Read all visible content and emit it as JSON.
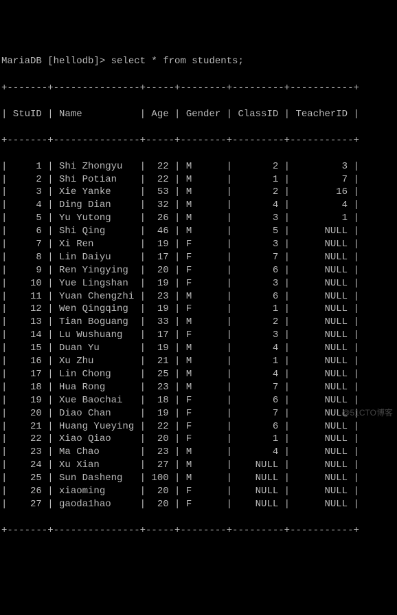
{
  "prompt": "MariaDB [hellodb]> select * from students;",
  "table": {
    "columns": [
      "StuID",
      "Name",
      "Age",
      "Gender",
      "ClassID",
      "TeacherID"
    ],
    "rows": [
      {
        "StuID": "1",
        "Name": "Shi Zhongyu",
        "Age": "22",
        "Gender": "M",
        "ClassID": "2",
        "TeacherID": "3"
      },
      {
        "StuID": "2",
        "Name": "Shi Potian",
        "Age": "22",
        "Gender": "M",
        "ClassID": "1",
        "TeacherID": "7"
      },
      {
        "StuID": "3",
        "Name": "Xie Yanke",
        "Age": "53",
        "Gender": "M",
        "ClassID": "2",
        "TeacherID": "16"
      },
      {
        "StuID": "4",
        "Name": "Ding Dian",
        "Age": "32",
        "Gender": "M",
        "ClassID": "4",
        "TeacherID": "4"
      },
      {
        "StuID": "5",
        "Name": "Yu Yutong",
        "Age": "26",
        "Gender": "M",
        "ClassID": "3",
        "TeacherID": "1"
      },
      {
        "StuID": "6",
        "Name": "Shi Qing",
        "Age": "46",
        "Gender": "M",
        "ClassID": "5",
        "TeacherID": "NULL"
      },
      {
        "StuID": "7",
        "Name": "Xi Ren",
        "Age": "19",
        "Gender": "F",
        "ClassID": "3",
        "TeacherID": "NULL"
      },
      {
        "StuID": "8",
        "Name": "Lin Daiyu",
        "Age": "17",
        "Gender": "F",
        "ClassID": "7",
        "TeacherID": "NULL"
      },
      {
        "StuID": "9",
        "Name": "Ren Yingying",
        "Age": "20",
        "Gender": "F",
        "ClassID": "6",
        "TeacherID": "NULL"
      },
      {
        "StuID": "10",
        "Name": "Yue Lingshan",
        "Age": "19",
        "Gender": "F",
        "ClassID": "3",
        "TeacherID": "NULL"
      },
      {
        "StuID": "11",
        "Name": "Yuan Chengzhi",
        "Age": "23",
        "Gender": "M",
        "ClassID": "6",
        "TeacherID": "NULL"
      },
      {
        "StuID": "12",
        "Name": "Wen Qingqing",
        "Age": "19",
        "Gender": "F",
        "ClassID": "1",
        "TeacherID": "NULL"
      },
      {
        "StuID": "13",
        "Name": "Tian Boguang",
        "Age": "33",
        "Gender": "M",
        "ClassID": "2",
        "TeacherID": "NULL"
      },
      {
        "StuID": "14",
        "Name": "Lu Wushuang",
        "Age": "17",
        "Gender": "F",
        "ClassID": "3",
        "TeacherID": "NULL"
      },
      {
        "StuID": "15",
        "Name": "Duan Yu",
        "Age": "19",
        "Gender": "M",
        "ClassID": "4",
        "TeacherID": "NULL"
      },
      {
        "StuID": "16",
        "Name": "Xu Zhu",
        "Age": "21",
        "Gender": "M",
        "ClassID": "1",
        "TeacherID": "NULL"
      },
      {
        "StuID": "17",
        "Name": "Lin Chong",
        "Age": "25",
        "Gender": "M",
        "ClassID": "4",
        "TeacherID": "NULL"
      },
      {
        "StuID": "18",
        "Name": "Hua Rong",
        "Age": "23",
        "Gender": "M",
        "ClassID": "7",
        "TeacherID": "NULL"
      },
      {
        "StuID": "19",
        "Name": "Xue Baochai",
        "Age": "18",
        "Gender": "F",
        "ClassID": "6",
        "TeacherID": "NULL"
      },
      {
        "StuID": "20",
        "Name": "Diao Chan",
        "Age": "19",
        "Gender": "F",
        "ClassID": "7",
        "TeacherID": "NULL"
      },
      {
        "StuID": "21",
        "Name": "Huang Yueying",
        "Age": "22",
        "Gender": "F",
        "ClassID": "6",
        "TeacherID": "NULL"
      },
      {
        "StuID": "22",
        "Name": "Xiao Qiao",
        "Age": "20",
        "Gender": "F",
        "ClassID": "1",
        "TeacherID": "NULL"
      },
      {
        "StuID": "23",
        "Name": "Ma Chao",
        "Age": "23",
        "Gender": "M",
        "ClassID": "4",
        "TeacherID": "NULL"
      },
      {
        "StuID": "24",
        "Name": "Xu Xian",
        "Age": "27",
        "Gender": "M",
        "ClassID": "NULL",
        "TeacherID": "NULL"
      },
      {
        "StuID": "25",
        "Name": "Sun Dasheng",
        "Age": "100",
        "Gender": "M",
        "ClassID": "NULL",
        "TeacherID": "NULL"
      },
      {
        "StuID": "26",
        "Name": "xiaoming",
        "Age": "20",
        "Gender": "F",
        "ClassID": "NULL",
        "TeacherID": "NULL"
      },
      {
        "StuID": "27",
        "Name": "gaoda1hao",
        "Age": "20",
        "Gender": "F",
        "ClassID": "NULL",
        "TeacherID": "NULL"
      }
    ]
  },
  "watermark": "@51CTO博客",
  "widths": {
    "StuID": 7,
    "Name": 15,
    "Age": 5,
    "Gender": 8,
    "ClassID": 9,
    "TeacherID": 11
  }
}
